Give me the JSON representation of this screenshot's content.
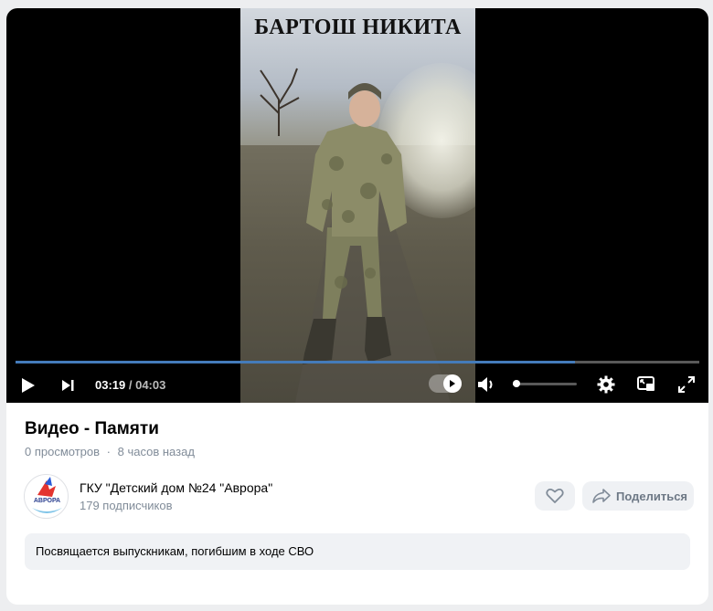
{
  "video": {
    "overlay_title": "БАРТОШ НИКИТА",
    "current_time": "03:19",
    "separator": " / ",
    "duration": "04:03",
    "progress_fraction": 0.818,
    "volume_fraction": 0.05
  },
  "info": {
    "title": "Видео - Памяти",
    "views": "0 просмотров",
    "dot": "·",
    "posted": "8 часов назад"
  },
  "channel": {
    "name": "ГКУ \"Детский дом №24 \"Аврора\"",
    "subscribers": "179 подписчиков",
    "avatar_text": "АВРОРА"
  },
  "actions": {
    "share_label": "Поделиться"
  },
  "description": "Посвящается выпускникам, погибшим в ходе СВО",
  "colors": {
    "accent": "#447bba",
    "muted": "#818c99",
    "button_bg": "#eff1f4"
  }
}
